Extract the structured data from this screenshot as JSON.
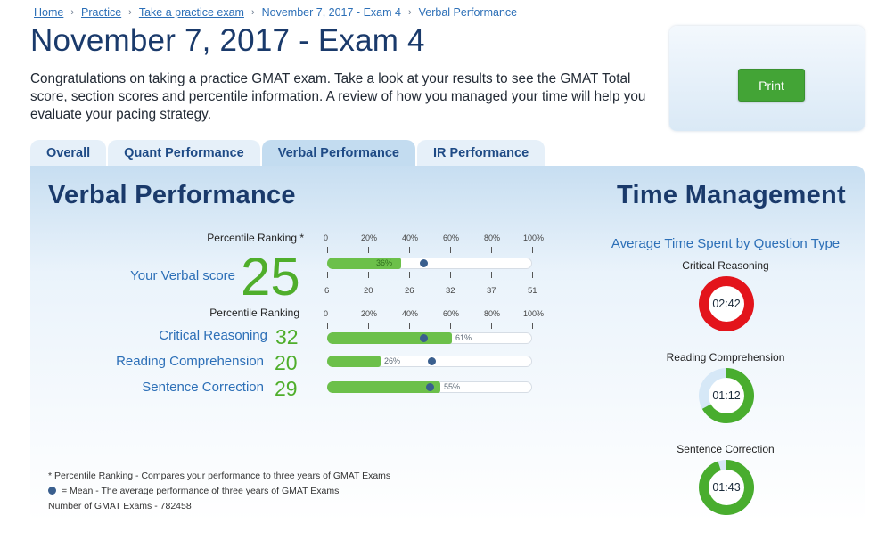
{
  "breadcrumb": {
    "home": "Home",
    "practice": "Practice",
    "take_exam": "Take a practice exam",
    "exam": "November 7, 2017 - Exam 4",
    "current": "Verbal Performance",
    "separator": "›"
  },
  "page_title": "November 7, 2017 - Exam 4",
  "intro": "Congratulations on taking a practice GMAT exam. Take a look at your results to see the GMAT Total score, section scores and percentile information. A review of how you managed your time will help you evaluate your pacing strategy.",
  "print_label": "Print",
  "tabs": [
    {
      "label": "Overall",
      "active": false
    },
    {
      "label": "Quant Performance",
      "active": false
    },
    {
      "label": "Verbal Performance",
      "active": true
    },
    {
      "label": "IR Performance",
      "active": false
    }
  ],
  "verbal": {
    "heading": "Verbal Performance",
    "percentile_label_star": "Percentile Ranking *",
    "percentile_label": "Percentile Ranking",
    "scale_top": [
      "0",
      "20%",
      "40%",
      "60%",
      "80%",
      "100%"
    ],
    "score_scale": [
      "6",
      "20",
      "26",
      "32",
      "37",
      "51"
    ],
    "score_label": "Your Verbal score",
    "score": "25",
    "score_percentile": 36,
    "score_percentile_label": "36%",
    "score_mean": 47,
    "rows": [
      {
        "label": "Critical Reasoning",
        "score": "32",
        "percentile": 61,
        "percentile_label": "61%",
        "mean": 47
      },
      {
        "label": "Reading Comprehension",
        "score": "20",
        "percentile": 26,
        "percentile_label": "26%",
        "mean": 51
      },
      {
        "label": "Sentence Correction",
        "score": "29",
        "percentile": 55,
        "percentile_label": "55%",
        "mean": 50
      }
    ],
    "footnotes": {
      "ranking": "* Percentile Ranking - Compares your performance to three years of GMAT Exams",
      "mean": "= Mean - The average performance of three years of GMAT Exams",
      "count": "Number of GMAT Exams - 782458"
    }
  },
  "time_management": {
    "heading": "Time Management",
    "subtitle": "Average Time Spent by Question Type",
    "items": [
      {
        "label": "Critical Reasoning",
        "time": "02:42",
        "fraction": 1.0,
        "color": "#e3141b"
      },
      {
        "label": "Reading Comprehension",
        "time": "01:12",
        "fraction": 0.67,
        "color": "#49ad2e"
      },
      {
        "label": "Sentence Correction",
        "time": "01:43",
        "fraction": 0.95,
        "color": "#49ad2e"
      }
    ]
  },
  "colors": {
    "accent_green": "#43a436",
    "bar_green": "#6cc04a",
    "link_blue": "#2c6fb7",
    "title_navy": "#1a3a6b",
    "mean_dot": "#3a5f8e",
    "donut_bg": "#d6e8f7"
  }
}
